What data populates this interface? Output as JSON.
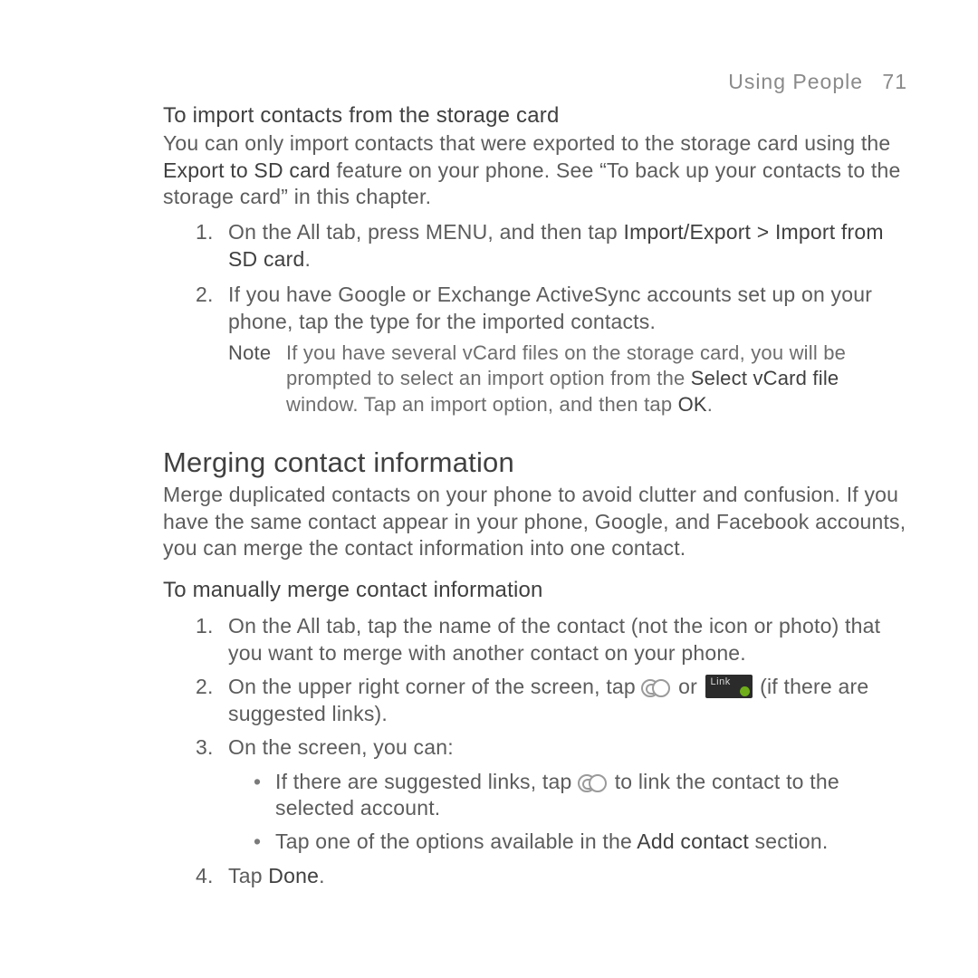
{
  "header": {
    "section": "Using People",
    "page_no": "71"
  },
  "import": {
    "heading": "To import contacts from the storage card",
    "intro": [
      "You can only import contacts that were exported to the storage card using the ",
      "Export to SD card",
      " feature on your phone. See “To back up your contacts to the storage card” in this chapter."
    ],
    "step1": [
      "On the All tab, press MENU, and then tap ",
      "Import/Export > Import from SD card",
      "."
    ],
    "step2": "If you have Google or Exchange ActiveSync accounts set up on your phone, tap the type for the imported contacts.",
    "note_label": "Note",
    "note": [
      "If you have several vCard files on the storage card, you will be prompted to select an import option from the ",
      "Select vCard file",
      " window. Tap an import option, and then tap ",
      "OK",
      "."
    ]
  },
  "merge": {
    "heading": "Merging contact information",
    "intro": "Merge duplicated contacts on your phone to avoid clutter and confusion. If you have the same contact appear in your phone, Google, and Facebook accounts, you can merge the contact information into one contact.",
    "sub": "To manually merge contact information",
    "s1": "On the All tab, tap the name of the contact (not the icon or photo) that you want to merge with another contact on your phone.",
    "s2a": "On the upper right corner of the screen, tap ",
    "s2b": " or ",
    "s2c": " (if there are suggested links).",
    "badge_text": "Link",
    "s3": "On the screen, you can:",
    "b1a": "If there are suggested links, tap ",
    "b1b": " to link the contact to the selected account.",
    "b2": [
      "Tap one of the options available in the ",
      "Add contact",
      " section."
    ],
    "s4": [
      "Tap ",
      "Done",
      "."
    ]
  },
  "nums": {
    "n1": "1.",
    "n2": "2.",
    "n3": "3.",
    "n4": "4."
  }
}
